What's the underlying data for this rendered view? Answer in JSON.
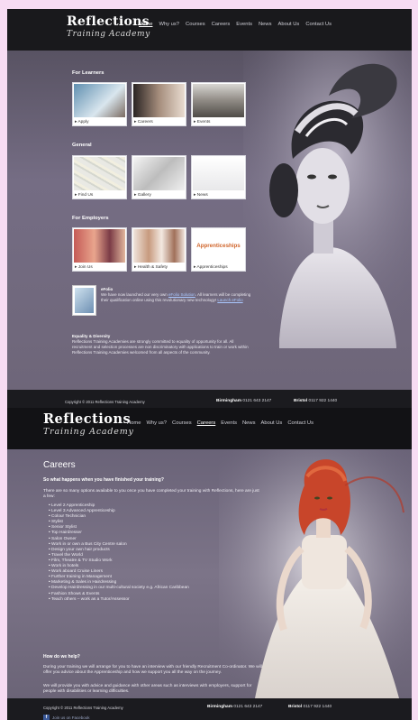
{
  "page1": {
    "logo": {
      "line1": "Reflections",
      "line2": "Training Academy"
    },
    "nav": [
      "Home",
      "Why us?",
      "Courses",
      "Careers",
      "Events",
      "News",
      "About Us",
      "Contact Us"
    ],
    "sections": {
      "learners": {
        "title": "For Learners",
        "tiles": [
          "Apply",
          "Careers",
          "Events"
        ]
      },
      "general": {
        "title": "General",
        "tiles": [
          "Find Us",
          "Gallery",
          "News"
        ]
      },
      "employers": {
        "title": "For Employers",
        "tiles": [
          "Join Us",
          "Health & Safety",
          "Apprenticeships"
        ],
        "apprenticeships_logo": "Apprenticeships"
      }
    },
    "efolio": {
      "title": "eFolio",
      "text_before_link": "We have now launched our very own",
      "link": "eFolio Solution",
      "text_after_link": ". All learners will be completing their qualification online using this revolutionary new technology!",
      "launch_link": "Launch eFolio"
    },
    "equality": {
      "title": "Equality & Diversity",
      "text": "Reflections Training Academies are strongly committed to equality of opportunity for all. All recruitment and selection processes are non discriminatory with applications to train or work within Reflections Training Academies welcomed from all aspects of the community."
    },
    "footer": {
      "copyright": "Copyright © 2011 Reflections Training Academy",
      "birmingham_label": "Birmingham",
      "birmingham_phone": "0121 643 2147",
      "bristol_label": "Bristol",
      "bristol_phone": "0117 922 1440"
    }
  },
  "page2": {
    "logo": {
      "line1": "Reflections",
      "line2": "Training Academy"
    },
    "nav": [
      "Home",
      "Why us?",
      "Courses",
      "Careers",
      "Events",
      "News",
      "About Us",
      "Contact Us"
    ],
    "title": "Careers",
    "question": "So what happens when you have finished your training?",
    "intro": "There are so many options available to you once you have completed your training with Reflections, here are just a few:",
    "careers": [
      "Level 2 Apprenticeship",
      "Level 3 Advanced Apprenticeship",
      "Colour Technician",
      "Stylist",
      "Senior Stylist",
      "Top Hairdresser",
      "Salon Owner",
      "Work in or own a Bus City Centre salon",
      "Design your own hair products",
      "Travel the World",
      "Film, Theatre & TV Studio Work",
      "Work in hotels",
      "Work aboard Cruise Liners",
      "Further training in Management",
      "Marketing & Sales in Hairdressing",
      "Develop Hairdressing in our multi-cultural society e.g. African Caribbean",
      "Fashion Shows & Events",
      "Teach others – work as a Tutor/Assessor"
    ],
    "help_title": "How do we help?",
    "help_p1": "During your training we will arrange for you to have an interview with our friendly Recruitment Co-ordinator. We will offer you advice about the Apprenticeship and how we support you all the way on the journey.",
    "help_p2": "We will provide you with advice and guidance with other areas such as interviews with employers, support for people with disabilities or learning difficulties.",
    "footer": {
      "copyright": "Copyright © 2011 Reflections Training Academy",
      "birmingham_label": "Birmingham",
      "birmingham_phone": "0121 643 2147",
      "bristol_label": "Bristol",
      "bristol_phone": "0117 922 1440",
      "facebook": "Join us on Facebook"
    }
  }
}
